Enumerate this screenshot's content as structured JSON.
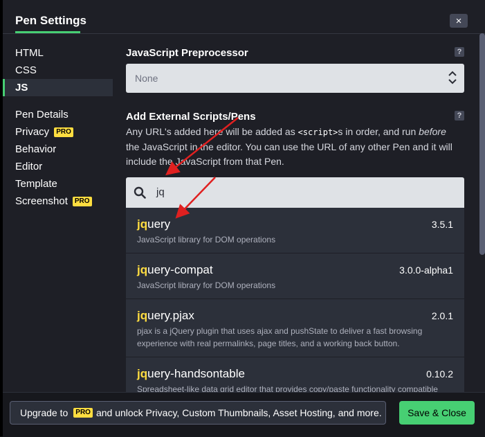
{
  "header": {
    "title": "Pen Settings",
    "close_icon": "×"
  },
  "sidebar": {
    "items": [
      {
        "label": "HTML"
      },
      {
        "label": "CSS"
      },
      {
        "label": "JS"
      },
      {
        "label": "Pen Details"
      },
      {
        "label": "Privacy",
        "badge": "PRO"
      },
      {
        "label": "Behavior"
      },
      {
        "label": "Editor"
      },
      {
        "label": "Template"
      },
      {
        "label": "Screenshot",
        "badge": "PRO"
      }
    ],
    "active": "JS"
  },
  "main": {
    "preprocessor": {
      "label": "JavaScript Preprocessor",
      "value": "None",
      "help": "?"
    },
    "external": {
      "label": "Add External Scripts/Pens",
      "help": "?",
      "desc_1": "Any URL's added here will be added as ",
      "desc_code": "<script>",
      "desc_2": "s in order, and run ",
      "desc_em": "before",
      "desc_3": " the JavaScript in the editor. You can use the URL of any other Pen and it will include the JavaScript from that Pen."
    },
    "search": {
      "value": "jq"
    },
    "results": [
      {
        "hl": "jq",
        "rest": "uery",
        "version": "3.5.1",
        "desc": "JavaScript library for DOM operations"
      },
      {
        "hl": "jq",
        "rest": "uery-compat",
        "version": "3.0.0-alpha1",
        "desc": "JavaScript library for DOM operations"
      },
      {
        "hl": "jq",
        "rest": "uery.pjax",
        "version": "2.0.1",
        "desc": "pjax is a jQuery plugin that uses ajax and pushState to deliver a fast browsing experience with real permalinks, page titles, and a working back button."
      },
      {
        "hl": "jq",
        "rest": "uery-handsontable",
        "version": "0.10.2",
        "desc": "Spreadsheet-like data grid editor that provides copy/paste functionality compatible"
      }
    ]
  },
  "footer": {
    "upgrade_pre": "Upgrade to",
    "upgrade_badge": "PRO",
    "upgrade_post": "and unlock Privacy, Custom Thumbnails, Asset Hosting, and more.",
    "save_label": "Save & Close"
  },
  "colors": {
    "accent": "#47cf73",
    "pro": "#ffdd40",
    "annotation_arrow": "#e02020"
  }
}
